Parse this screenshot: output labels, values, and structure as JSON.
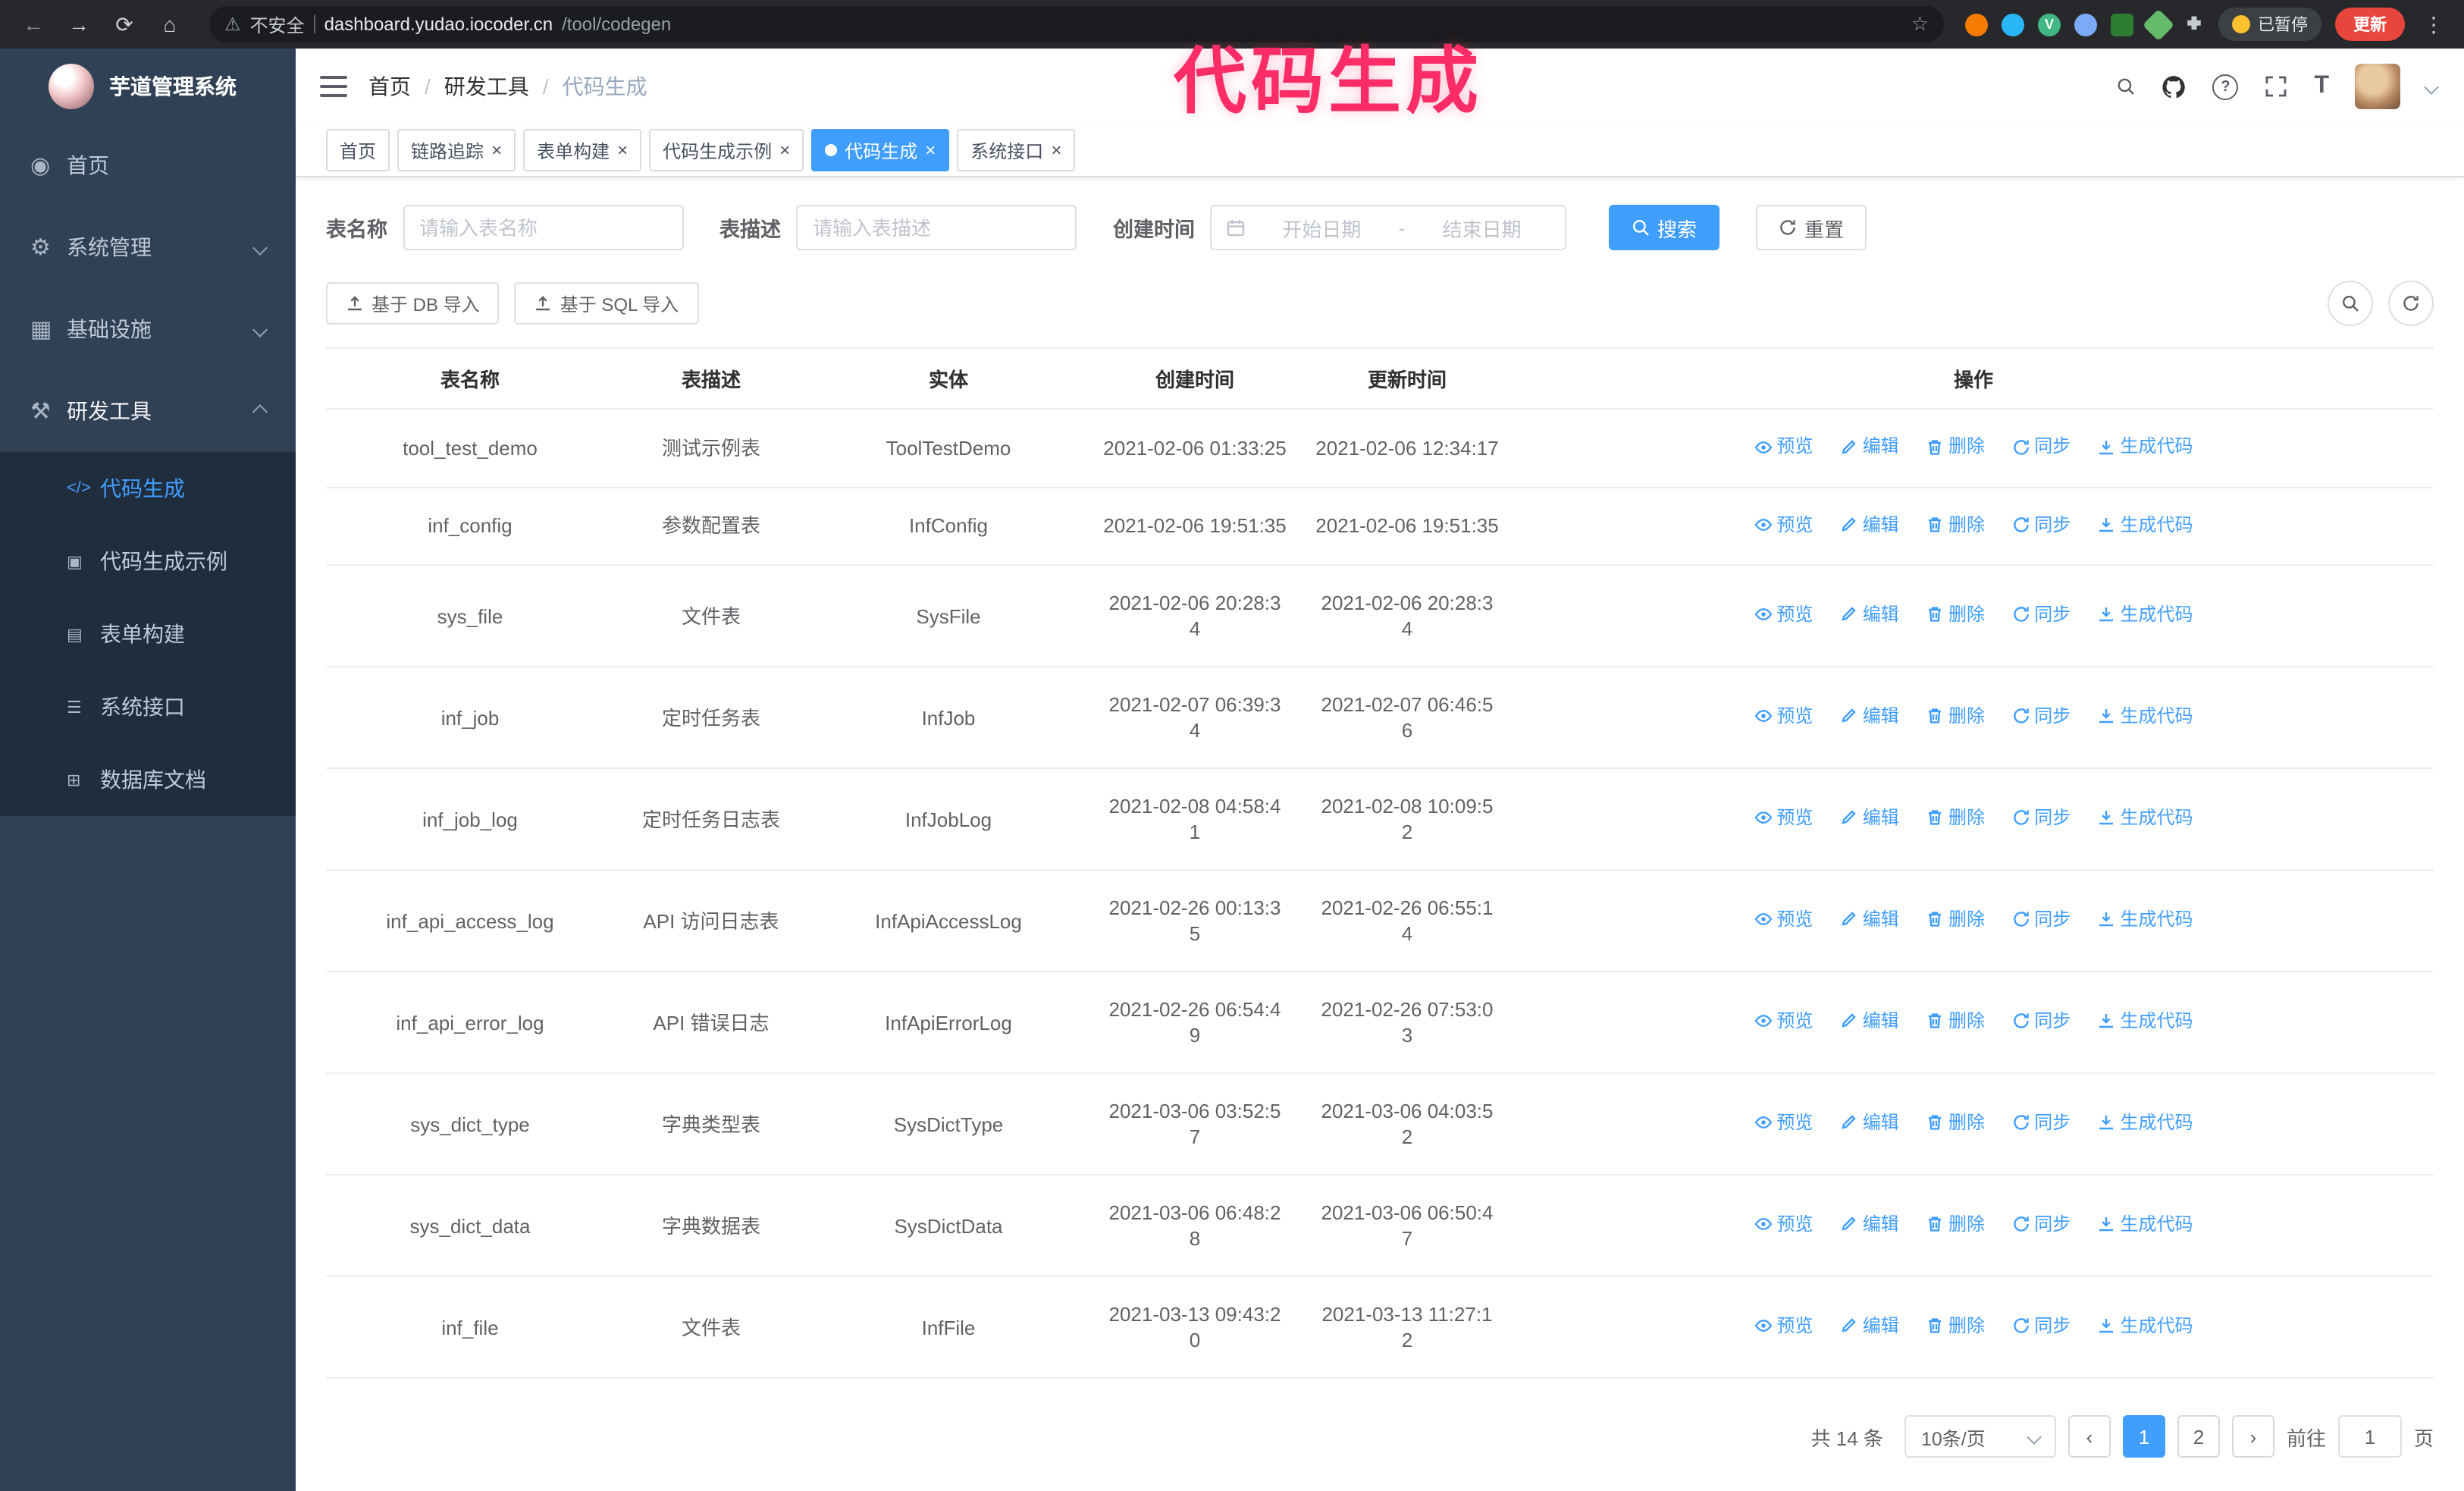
{
  "colors": {
    "accent": "#409eff",
    "annotation": "#fb2c66",
    "sidebar_bg": "#304156",
    "submenu_bg": "#1f2d3d",
    "update_button_bg": "#e8453c"
  },
  "annotation": {
    "text": "代码生成"
  },
  "browser": {
    "security_label": "不安全",
    "url_host": "dashboard.yudao.iocoder.cn",
    "url_path": "/tool/codegen",
    "paused_badge": "已暂停",
    "update_button": "更新"
  },
  "sidebar": {
    "logo_title": "芋道管理系统",
    "items": [
      {
        "label": "首页",
        "glyph": "◉"
      },
      {
        "label": "系统管理",
        "glyph": "⚙"
      },
      {
        "label": "基础设施",
        "glyph": "▦"
      },
      {
        "label": "研发工具",
        "glyph": "⚒"
      }
    ],
    "submenu": [
      {
        "label": "代码生成",
        "glyph": "</>"
      },
      {
        "label": "代码生成示例",
        "glyph": "▣"
      },
      {
        "label": "表单构建",
        "glyph": "▤"
      },
      {
        "label": "系统接口",
        "glyph": "☰"
      },
      {
        "label": "数据库文档",
        "glyph": "⊞"
      }
    ]
  },
  "header": {
    "breadcrumb": [
      "首页",
      "研发工具",
      "代码生成"
    ]
  },
  "tabs": [
    {
      "label": "首页"
    },
    {
      "label": "链路追踪"
    },
    {
      "label": "表单构建"
    },
    {
      "label": "代码生成示例"
    },
    {
      "label": "代码生成"
    },
    {
      "label": "系统接口"
    }
  ],
  "filters": {
    "table_name_label": "表名称",
    "table_name_placeholder": "请输入表名称",
    "table_desc_label": "表描述",
    "table_desc_placeholder": "请输入表描述",
    "create_time_label": "创建时间",
    "date_start_placeholder": "开始日期",
    "date_separator": "-",
    "date_end_placeholder": "结束日期",
    "search_button": "搜索",
    "reset_button": "重置"
  },
  "toolbar": {
    "import_db_button": "基于 DB 导入",
    "import_sql_button": "基于 SQL 导入"
  },
  "table": {
    "columns": [
      "表名称",
      "表描述",
      "实体",
      "创建时间",
      "更新时间",
      "操作"
    ],
    "actions": [
      "预览",
      "编辑",
      "删除",
      "同步",
      "生成代码"
    ],
    "rows": [
      {
        "name": "tool_test_demo",
        "desc": "测试示例表",
        "entity": "ToolTestDemo",
        "created": "2021-02-06 01:33:25",
        "updated": "2021-02-06 12:34:17"
      },
      {
        "name": "inf_config",
        "desc": "参数配置表",
        "entity": "InfConfig",
        "created": "2021-02-06 19:51:35",
        "updated": "2021-02-06 19:51:35"
      },
      {
        "name": "sys_file",
        "desc": "文件表",
        "entity": "SysFile",
        "created": "2021-02-06 20:28:34",
        "updated": "2021-02-06 20:28:34"
      },
      {
        "name": "inf_job",
        "desc": "定时任务表",
        "entity": "InfJob",
        "created": "2021-02-07 06:39:34",
        "updated": "2021-02-07 06:46:56"
      },
      {
        "name": "inf_job_log",
        "desc": "定时任务日志表",
        "entity": "InfJobLog",
        "created": "2021-02-08 04:58:41",
        "updated": "2021-02-08 10:09:52"
      },
      {
        "name": "inf_api_access_log",
        "desc": "API 访问日志表",
        "entity": "InfApiAccessLog",
        "created": "2021-02-26 00:13:35",
        "updated": "2021-02-26 06:55:14"
      },
      {
        "name": "inf_api_error_log",
        "desc": "API 错误日志",
        "entity": "InfApiErrorLog",
        "created": "2021-02-26 06:54:49",
        "updated": "2021-02-26 07:53:03"
      },
      {
        "name": "sys_dict_type",
        "desc": "字典类型表",
        "entity": "SysDictType",
        "created": "2021-03-06 03:52:57",
        "updated": "2021-03-06 04:03:52"
      },
      {
        "name": "sys_dict_data",
        "desc": "字典数据表",
        "entity": "SysDictData",
        "created": "2021-03-06 06:48:28",
        "updated": "2021-03-06 06:50:47"
      },
      {
        "name": "inf_file",
        "desc": "文件表",
        "entity": "InfFile",
        "created": "2021-03-13 09:43:20",
        "updated": "2021-03-13 11:27:12"
      }
    ]
  },
  "pagination": {
    "total": "共 14 条",
    "page_size": "10条/页",
    "pages": [
      "1",
      "2"
    ],
    "active_page": "1",
    "goto_label": "前往",
    "goto_value": "1",
    "goto_suffix": "页"
  }
}
